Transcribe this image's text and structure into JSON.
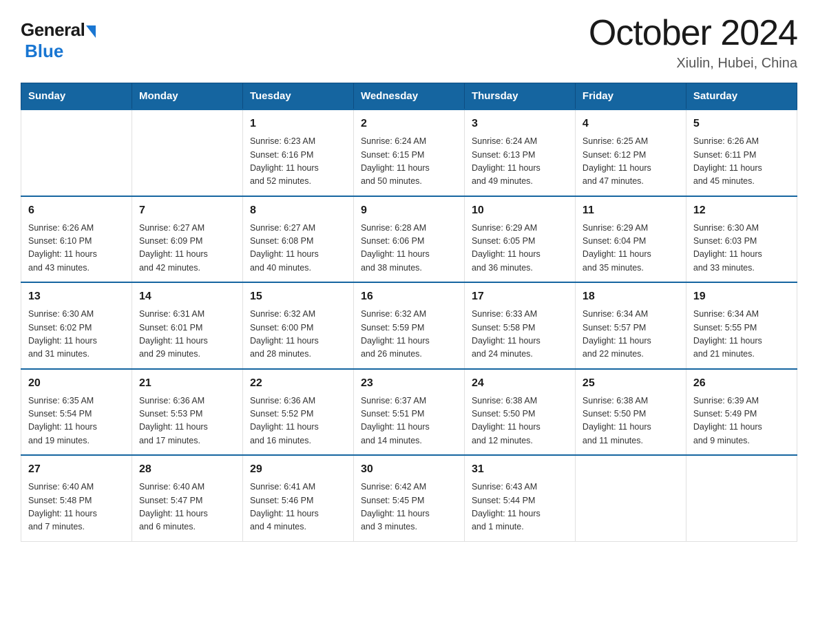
{
  "logo": {
    "general": "General",
    "blue": "Blue"
  },
  "title": "October 2024",
  "location": "Xiulin, Hubei, China",
  "days_of_week": [
    "Sunday",
    "Monday",
    "Tuesday",
    "Wednesday",
    "Thursday",
    "Friday",
    "Saturday"
  ],
  "weeks": [
    [
      {
        "day": "",
        "info": ""
      },
      {
        "day": "",
        "info": ""
      },
      {
        "day": "1",
        "info": "Sunrise: 6:23 AM\nSunset: 6:16 PM\nDaylight: 11 hours\nand 52 minutes."
      },
      {
        "day": "2",
        "info": "Sunrise: 6:24 AM\nSunset: 6:15 PM\nDaylight: 11 hours\nand 50 minutes."
      },
      {
        "day": "3",
        "info": "Sunrise: 6:24 AM\nSunset: 6:13 PM\nDaylight: 11 hours\nand 49 minutes."
      },
      {
        "day": "4",
        "info": "Sunrise: 6:25 AM\nSunset: 6:12 PM\nDaylight: 11 hours\nand 47 minutes."
      },
      {
        "day": "5",
        "info": "Sunrise: 6:26 AM\nSunset: 6:11 PM\nDaylight: 11 hours\nand 45 minutes."
      }
    ],
    [
      {
        "day": "6",
        "info": "Sunrise: 6:26 AM\nSunset: 6:10 PM\nDaylight: 11 hours\nand 43 minutes."
      },
      {
        "day": "7",
        "info": "Sunrise: 6:27 AM\nSunset: 6:09 PM\nDaylight: 11 hours\nand 42 minutes."
      },
      {
        "day": "8",
        "info": "Sunrise: 6:27 AM\nSunset: 6:08 PM\nDaylight: 11 hours\nand 40 minutes."
      },
      {
        "day": "9",
        "info": "Sunrise: 6:28 AM\nSunset: 6:06 PM\nDaylight: 11 hours\nand 38 minutes."
      },
      {
        "day": "10",
        "info": "Sunrise: 6:29 AM\nSunset: 6:05 PM\nDaylight: 11 hours\nand 36 minutes."
      },
      {
        "day": "11",
        "info": "Sunrise: 6:29 AM\nSunset: 6:04 PM\nDaylight: 11 hours\nand 35 minutes."
      },
      {
        "day": "12",
        "info": "Sunrise: 6:30 AM\nSunset: 6:03 PM\nDaylight: 11 hours\nand 33 minutes."
      }
    ],
    [
      {
        "day": "13",
        "info": "Sunrise: 6:30 AM\nSunset: 6:02 PM\nDaylight: 11 hours\nand 31 minutes."
      },
      {
        "day": "14",
        "info": "Sunrise: 6:31 AM\nSunset: 6:01 PM\nDaylight: 11 hours\nand 29 minutes."
      },
      {
        "day": "15",
        "info": "Sunrise: 6:32 AM\nSunset: 6:00 PM\nDaylight: 11 hours\nand 28 minutes."
      },
      {
        "day": "16",
        "info": "Sunrise: 6:32 AM\nSunset: 5:59 PM\nDaylight: 11 hours\nand 26 minutes."
      },
      {
        "day": "17",
        "info": "Sunrise: 6:33 AM\nSunset: 5:58 PM\nDaylight: 11 hours\nand 24 minutes."
      },
      {
        "day": "18",
        "info": "Sunrise: 6:34 AM\nSunset: 5:57 PM\nDaylight: 11 hours\nand 22 minutes."
      },
      {
        "day": "19",
        "info": "Sunrise: 6:34 AM\nSunset: 5:55 PM\nDaylight: 11 hours\nand 21 minutes."
      }
    ],
    [
      {
        "day": "20",
        "info": "Sunrise: 6:35 AM\nSunset: 5:54 PM\nDaylight: 11 hours\nand 19 minutes."
      },
      {
        "day": "21",
        "info": "Sunrise: 6:36 AM\nSunset: 5:53 PM\nDaylight: 11 hours\nand 17 minutes."
      },
      {
        "day": "22",
        "info": "Sunrise: 6:36 AM\nSunset: 5:52 PM\nDaylight: 11 hours\nand 16 minutes."
      },
      {
        "day": "23",
        "info": "Sunrise: 6:37 AM\nSunset: 5:51 PM\nDaylight: 11 hours\nand 14 minutes."
      },
      {
        "day": "24",
        "info": "Sunrise: 6:38 AM\nSunset: 5:50 PM\nDaylight: 11 hours\nand 12 minutes."
      },
      {
        "day": "25",
        "info": "Sunrise: 6:38 AM\nSunset: 5:50 PM\nDaylight: 11 hours\nand 11 minutes."
      },
      {
        "day": "26",
        "info": "Sunrise: 6:39 AM\nSunset: 5:49 PM\nDaylight: 11 hours\nand 9 minutes."
      }
    ],
    [
      {
        "day": "27",
        "info": "Sunrise: 6:40 AM\nSunset: 5:48 PM\nDaylight: 11 hours\nand 7 minutes."
      },
      {
        "day": "28",
        "info": "Sunrise: 6:40 AM\nSunset: 5:47 PM\nDaylight: 11 hours\nand 6 minutes."
      },
      {
        "day": "29",
        "info": "Sunrise: 6:41 AM\nSunset: 5:46 PM\nDaylight: 11 hours\nand 4 minutes."
      },
      {
        "day": "30",
        "info": "Sunrise: 6:42 AM\nSunset: 5:45 PM\nDaylight: 11 hours\nand 3 minutes."
      },
      {
        "day": "31",
        "info": "Sunrise: 6:43 AM\nSunset: 5:44 PM\nDaylight: 11 hours\nand 1 minute."
      },
      {
        "day": "",
        "info": ""
      },
      {
        "day": "",
        "info": ""
      }
    ]
  ]
}
